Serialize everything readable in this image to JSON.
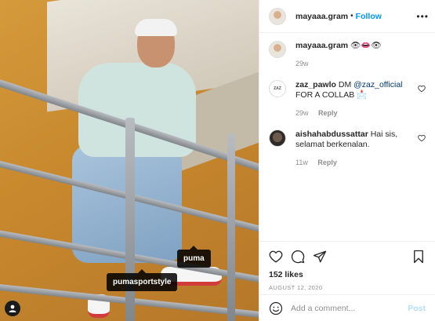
{
  "photo": {
    "tags": [
      {
        "label": "puma"
      },
      {
        "label": "pumasportstyle"
      }
    ]
  },
  "header": {
    "username": "mayaaa.gram",
    "separator": "•",
    "follow_label": "Follow",
    "more_label": "•••"
  },
  "comments": [
    {
      "username": "mayaaa.gram",
      "text": "👁👄👁",
      "time": "29w"
    },
    {
      "username": "zaz_pawlo",
      "text_pre": "DM ",
      "mention": "@zaz_official",
      "text_post": " FOR A COLLAB 📩",
      "time": "29w",
      "reply": "Reply",
      "avatar_text": "ZAZ"
    },
    {
      "username": "aishahabdussattar",
      "text": "Hai sis, selamat berkenalan.",
      "time": "11w",
      "reply": "Reply"
    }
  ],
  "stats": {
    "likes": "152 likes",
    "date": "AUGUST 12, 2020"
  },
  "add_comment": {
    "placeholder": "Add a comment...",
    "post_label": "Post"
  }
}
